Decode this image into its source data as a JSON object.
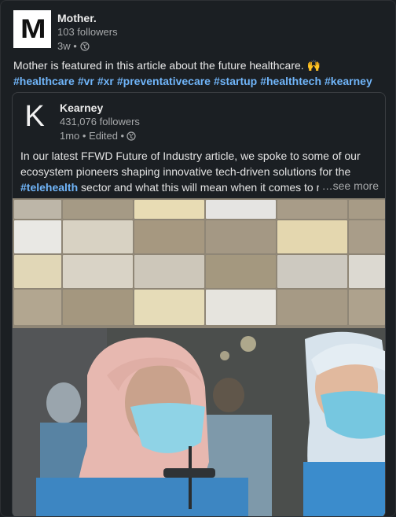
{
  "post": {
    "author": {
      "logo_letter": "M",
      "name": "Mother.",
      "followers": "103 followers",
      "time": "3w •"
    },
    "commentary": "Mother is featured in this article about the future healthcare. 🙌",
    "hashtags": [
      "#healthcare",
      "#vr",
      "#xr",
      "#preventativecare",
      "#startup",
      "#healthtech",
      "#kearney"
    ]
  },
  "shared": {
    "author": {
      "logo_letter": "K",
      "name": "Kearney",
      "followers": "431,076 followers",
      "time": "1mo • Edited •"
    },
    "text_line1": "In our latest FFWD Future of Industry article, we spoke to some of our",
    "text_line2": "ecosystem pioneers shaping innovative tech-driven solutions for the",
    "text_tag": "#telehealth",
    "text_line3_rest": " sector and what this will mean when it comes to redef",
    "see_more": "…see more"
  },
  "icons": {
    "privacy": "globe-icon"
  },
  "colors": {
    "background": "#1b1f23",
    "hashtag": "#70b5f9",
    "muted": "#a6a8aa"
  }
}
